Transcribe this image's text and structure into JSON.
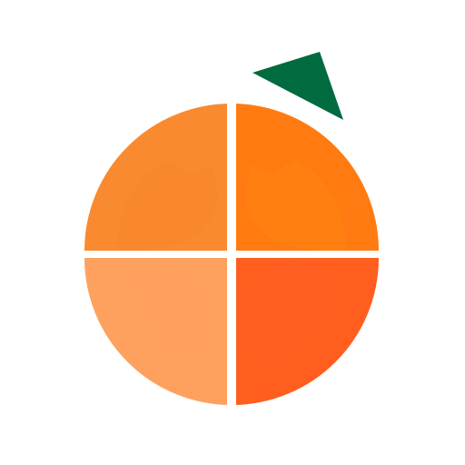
{
  "logo": {
    "icon": "orange-fruit-logo-icon",
    "colors": {
      "background": "#ffffff",
      "leaf": "#006b3f",
      "quadrant_top_left_ring": "#f98a2f",
      "quadrant_top_left_petal": "#f9872d",
      "quadrant_top_right_ring": "#ff7b12",
      "quadrant_top_right_petal": "#ff7f10",
      "quadrant_bottom_left_ring": "#fea15f",
      "quadrant_bottom_left_petal": "#ffa05e",
      "quadrant_bottom_right_ring": "#ff5e1f",
      "quadrant_bottom_right_petal": "#ff5f21"
    }
  }
}
